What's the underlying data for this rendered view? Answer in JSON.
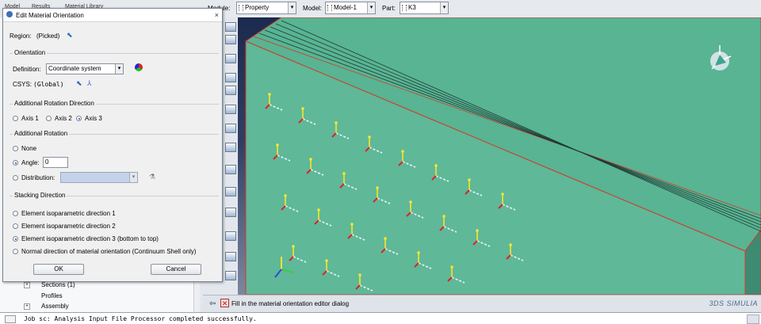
{
  "toolbar": {
    "module_tabs": [
      "Model",
      "Results",
      "Material Library"
    ],
    "module_label": "Module:",
    "module_value": "Property",
    "model_label": "Model:",
    "model_value": "Model-1",
    "part_label": "Part:",
    "part_value": "K3"
  },
  "tree": {
    "items": [
      "Sections (1)",
      "Profiles",
      "Assembly"
    ]
  },
  "dialog": {
    "title": "Edit Material Orientation",
    "close_glyph": "×",
    "region_label": "Region:",
    "region_value": "(Picked)",
    "orientation": {
      "title": "Orientation",
      "definition_label": "Definition:",
      "definition_value": "Coordinate system",
      "csys_label": "CSYS:",
      "csys_value": "(Global)"
    },
    "rotation_direction": {
      "title": "Additional Rotation Direction",
      "options": [
        "Axis 1",
        "Axis 2",
        "Axis 3"
      ],
      "selected": 2
    },
    "rotation": {
      "title": "Additional Rotation",
      "none_label": "None",
      "angle_label": "Angle:",
      "angle_value": "0",
      "distribution_label": "Distribution:",
      "selected": "angle"
    },
    "stacking": {
      "title": "Stacking Direction",
      "options": [
        "Element isoparametric direction 1",
        "Element isoparametric direction 2",
        "Element isoparametric direction 3 (bottom to top)",
        "Normal direction of material orientation (Continuum Shell only)"
      ],
      "selected": 2
    },
    "ok_label": "OK",
    "cancel_label": "Cancel"
  },
  "prompt": {
    "text": "Fill in the material orientation editor dialog",
    "logo": "3DS SIMULIA"
  },
  "message": {
    "text": "Job sc: Analysis Input File Processor completed successfully."
  },
  "colors": {
    "solid_face": "#5fb898",
    "edge_red": "#d23a2a",
    "axis1": "#e8f4ff",
    "axis2": "#f5e72b",
    "axis3": "#d8262a"
  }
}
